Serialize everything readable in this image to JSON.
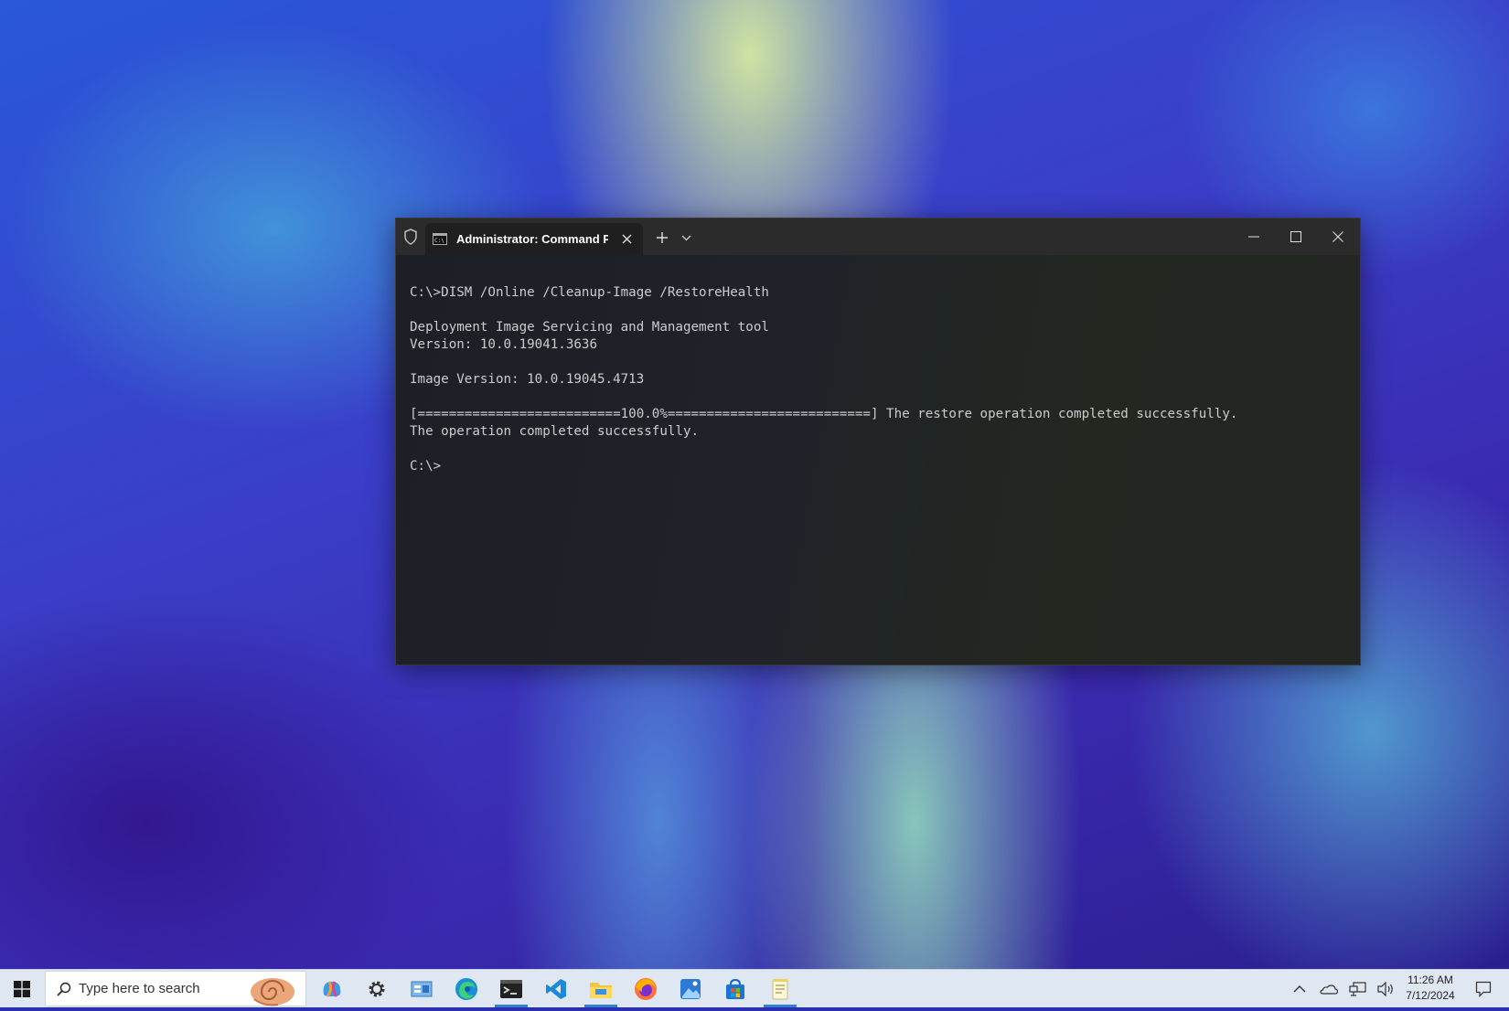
{
  "window": {
    "tab_title": "Administrator: Command Prompt",
    "buttons": {
      "minimize": "minimize-icon",
      "maximize": "maximize-icon",
      "close": "close-icon"
    }
  },
  "console": {
    "lines": [
      "C:\\>DISM /Online /Cleanup-Image /RestoreHealth",
      "",
      "Deployment Image Servicing and Management tool",
      "Version: 10.0.19041.3636",
      "",
      "Image Version: 10.0.19045.4713",
      "",
      "[==========================100.0%==========================] The restore operation completed successfully.",
      "The operation completed successfully.",
      "",
      "C:\\>"
    ]
  },
  "taskbar": {
    "search_placeholder": "Type here to search",
    "apps": [
      "copilot-icon",
      "settings-icon",
      "control-panel-icon",
      "edge-icon",
      "terminal-icon",
      "vscode-icon",
      "file-explorer-icon",
      "firefox-icon",
      "photos-icon",
      "store-icon",
      "notepad-icon"
    ],
    "clock": {
      "time": "11:26 AM",
      "date": "7/12/2024"
    }
  },
  "colors": {
    "accent": "#2f7fd8",
    "console_text": "#cccccc",
    "titlebar": "#2b2b2b"
  }
}
